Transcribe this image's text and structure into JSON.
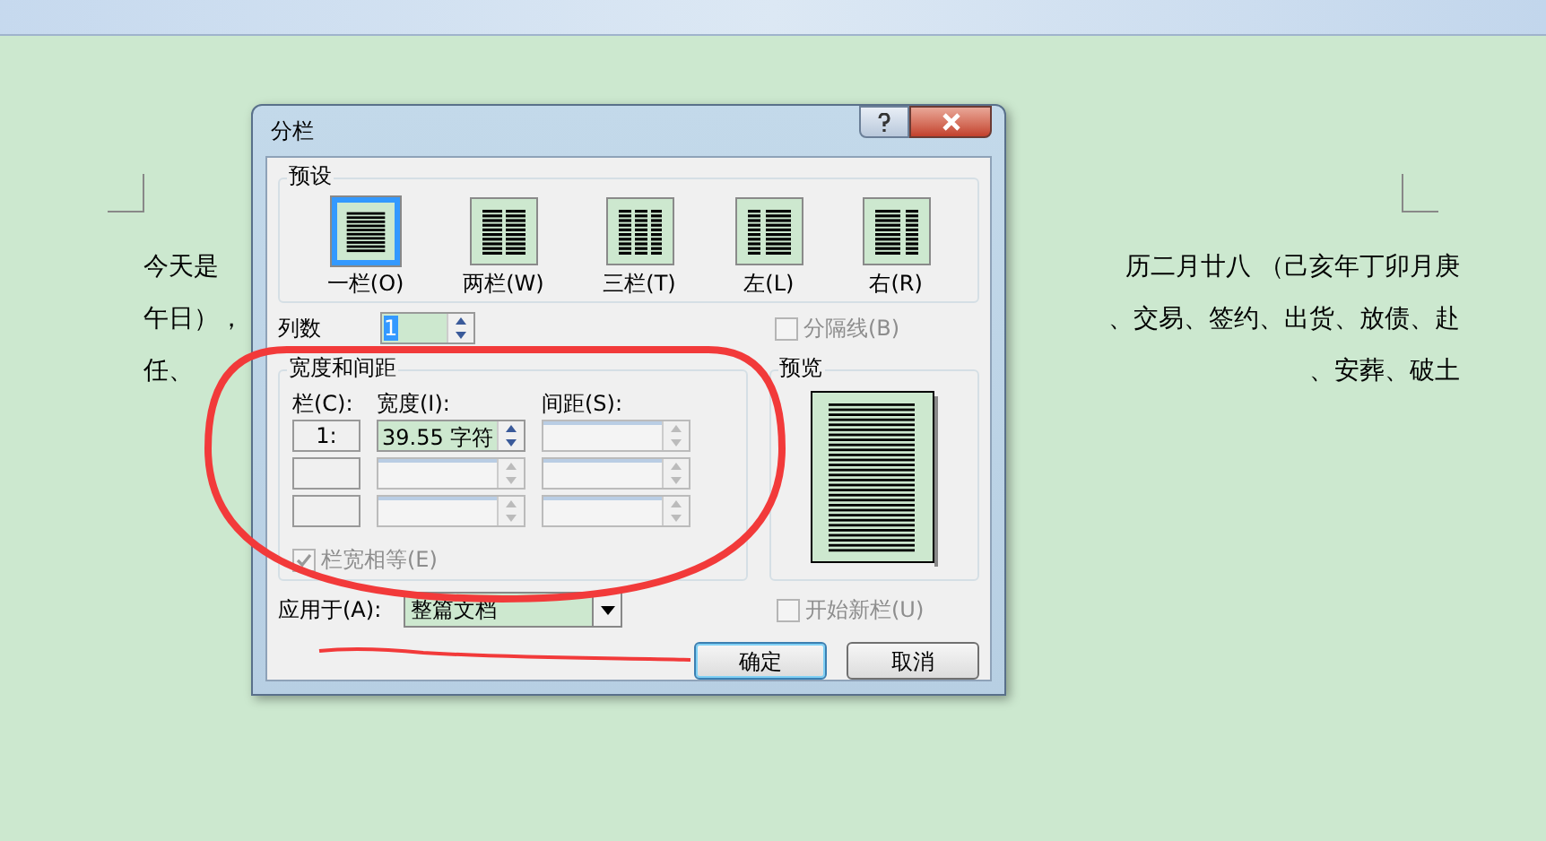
{
  "document": {
    "lines": [
      {
        "left": "今天是",
        "right": "历二月廿八 （己亥年丁卯月庚"
      },
      {
        "left": "午日），",
        "right": "、交易、签约、出货、放债、赴"
      },
      {
        "left": "任、",
        "right": "、安葬、破土"
      }
    ]
  },
  "dialog": {
    "title": "分栏",
    "presets_label": "预设",
    "presets": [
      {
        "kind": "one",
        "label": "一栏(O)",
        "selected": true
      },
      {
        "kind": "two",
        "label": "两栏(W)",
        "selected": false
      },
      {
        "kind": "three",
        "label": "三栏(T)",
        "selected": false
      },
      {
        "kind": "left",
        "label": "左(L)",
        "selected": false
      },
      {
        "kind": "right",
        "label": "右(R)",
        "selected": false
      }
    ],
    "column_count": {
      "label": "列数",
      "value": "1"
    },
    "divider": {
      "label": "分隔线(B)",
      "checked": false,
      "disabled": true
    },
    "width_spacing": {
      "label": "宽度和间距",
      "headers": [
        "栏(C):",
        "宽度(I):",
        "间距(S):"
      ],
      "rows": [
        {
          "number": "1:",
          "width": "39.55 字符",
          "disabled": false
        },
        {
          "disabled": true
        },
        {
          "disabled": true
        }
      ],
      "equal_width": {
        "label": "栏宽相等(E)",
        "checked": true,
        "disabled": true
      }
    },
    "preview_label": "预览",
    "apply_to": {
      "label": "应用于(A):",
      "value": "整篇文档"
    },
    "start_new_column": {
      "label": "开始新栏(U)",
      "checked": false,
      "disabled": true
    },
    "buttons": [
      {
        "label": "确定",
        "default": true
      },
      {
        "label": "取消",
        "default": false
      }
    ]
  }
}
